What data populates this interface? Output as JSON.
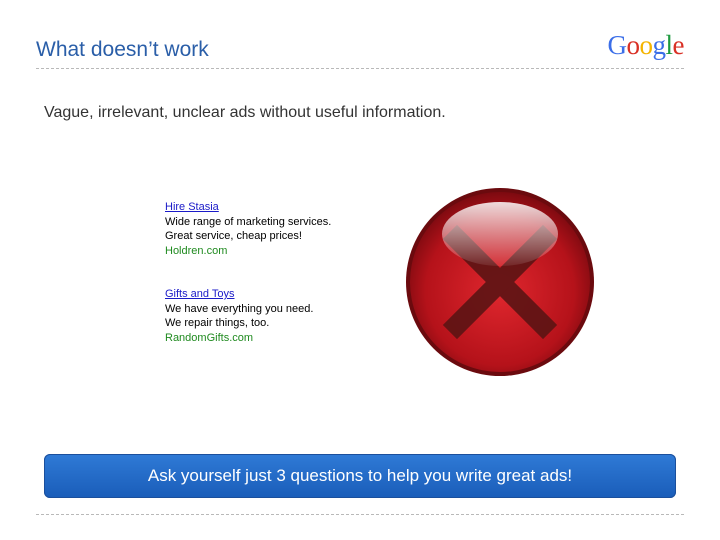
{
  "title": "What doesn’t work",
  "logo": {
    "letters": [
      {
        "ch": "G",
        "color": "#3b6ee8"
      },
      {
        "ch": "o",
        "color": "#d93025"
      },
      {
        "ch": "o",
        "color": "#f4b400"
      },
      {
        "ch": "g",
        "color": "#3b6ee8"
      },
      {
        "ch": "l",
        "color": "#1e9a40"
      },
      {
        "ch": "e",
        "color": "#d93025"
      }
    ]
  },
  "subtitle": "Vague, irrelevant, unclear ads without useful information.",
  "ads": [
    {
      "headline": "Hire Stasia",
      "line1": "Wide range of marketing services.",
      "line2": "Great service, cheap prices!",
      "url": "Holdren.com"
    },
    {
      "headline": "Gifts and Toys",
      "line1": "We have everything you need.",
      "line2": "We repair things, too.",
      "url": "RandomGifts.com"
    }
  ],
  "cross_icon": "red-x-icon",
  "banner": {
    "text": "Ask yourself just 3 questions to help you write great ads!"
  },
  "colors": {
    "title": "#2a5ea8",
    "ad_headline": "#1a1ac8",
    "ad_url": "#1f8a1f",
    "banner": "#1f66c4",
    "x_circle": "#c8181f"
  }
}
